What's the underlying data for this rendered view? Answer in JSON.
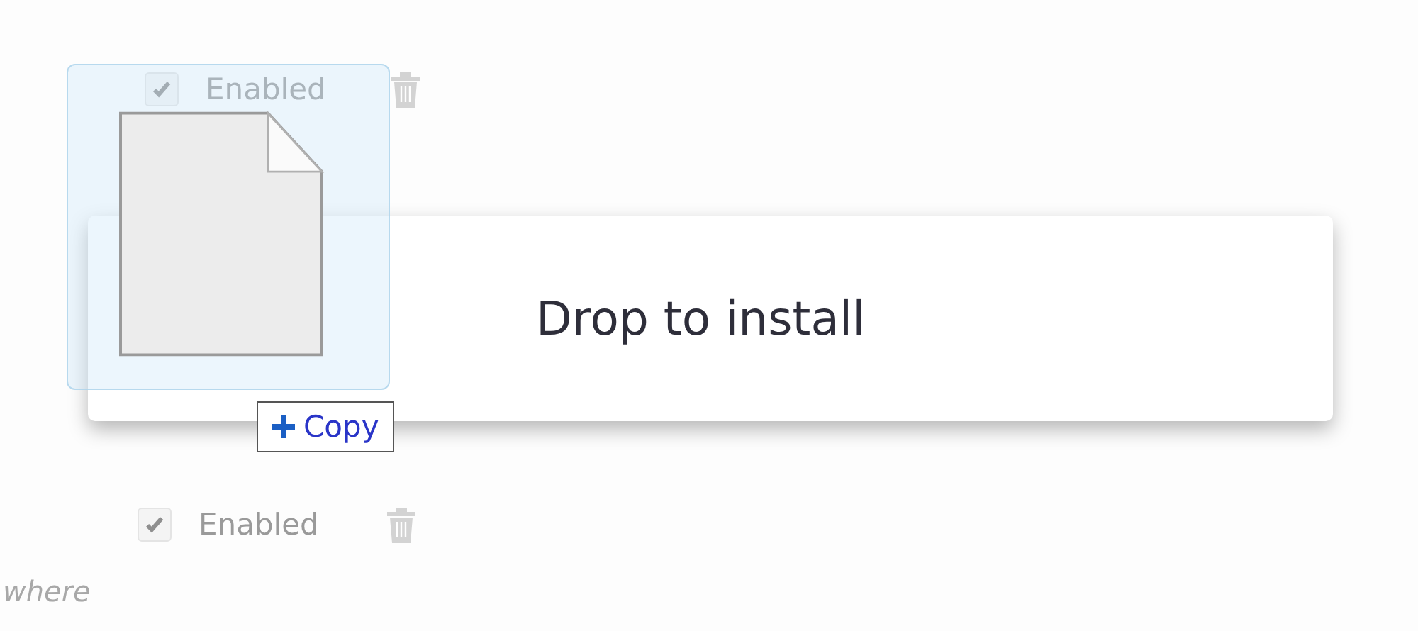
{
  "extensions": [
    {
      "enabled_label": "Enabled",
      "checked": true
    },
    {
      "enabled_label": "Enabled",
      "checked": true
    }
  ],
  "footer_text": "where",
  "drop_overlay": {
    "message": "Drop to install"
  },
  "drag_cursor": {
    "label": "Copy"
  }
}
